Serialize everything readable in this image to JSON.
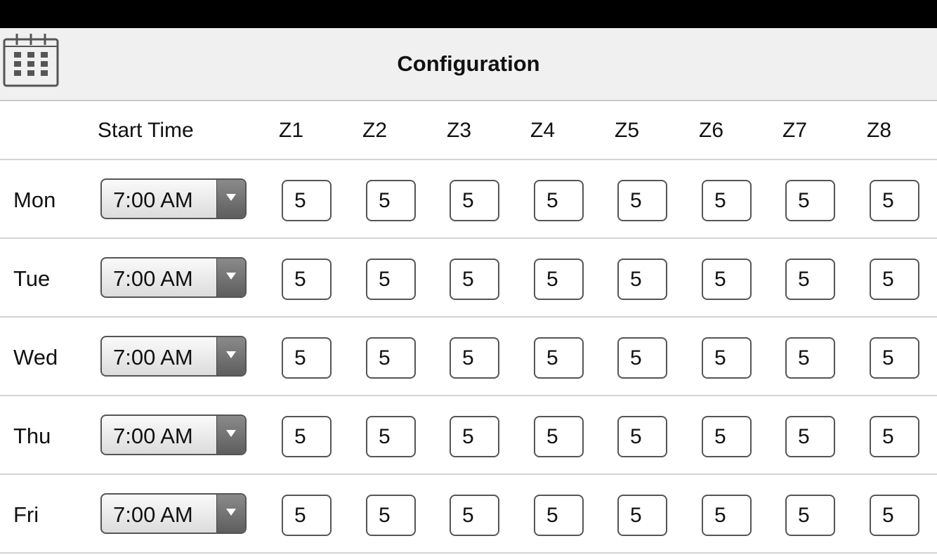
{
  "header": {
    "title": "Configuration",
    "calendar_icon": "calendar-icon"
  },
  "table": {
    "start_time_header": "Start Time",
    "zones": [
      "Z1",
      "Z2",
      "Z3",
      "Z4",
      "Z5",
      "Z6",
      "Z7",
      "Z8"
    ],
    "rows": [
      {
        "day": "Mon",
        "start_time": "7:00 AM",
        "zones": [
          "5",
          "5",
          "5",
          "5",
          "5",
          "5",
          "5",
          "5"
        ]
      },
      {
        "day": "Tue",
        "start_time": "7:00 AM",
        "zones": [
          "5",
          "5",
          "5",
          "5",
          "5",
          "5",
          "5",
          "5"
        ]
      },
      {
        "day": "Wed",
        "start_time": "7:00 AM",
        "zones": [
          "5",
          "5",
          "5",
          "5",
          "5",
          "5",
          "5",
          "5"
        ]
      },
      {
        "day": "Thu",
        "start_time": "7:00 AM",
        "zones": [
          "5",
          "5",
          "5",
          "5",
          "5",
          "5",
          "5",
          "5"
        ]
      },
      {
        "day": "Fri",
        "start_time": "7:00 AM",
        "zones": [
          "5",
          "5",
          "5",
          "5",
          "5",
          "5",
          "5",
          "5"
        ]
      }
    ]
  }
}
